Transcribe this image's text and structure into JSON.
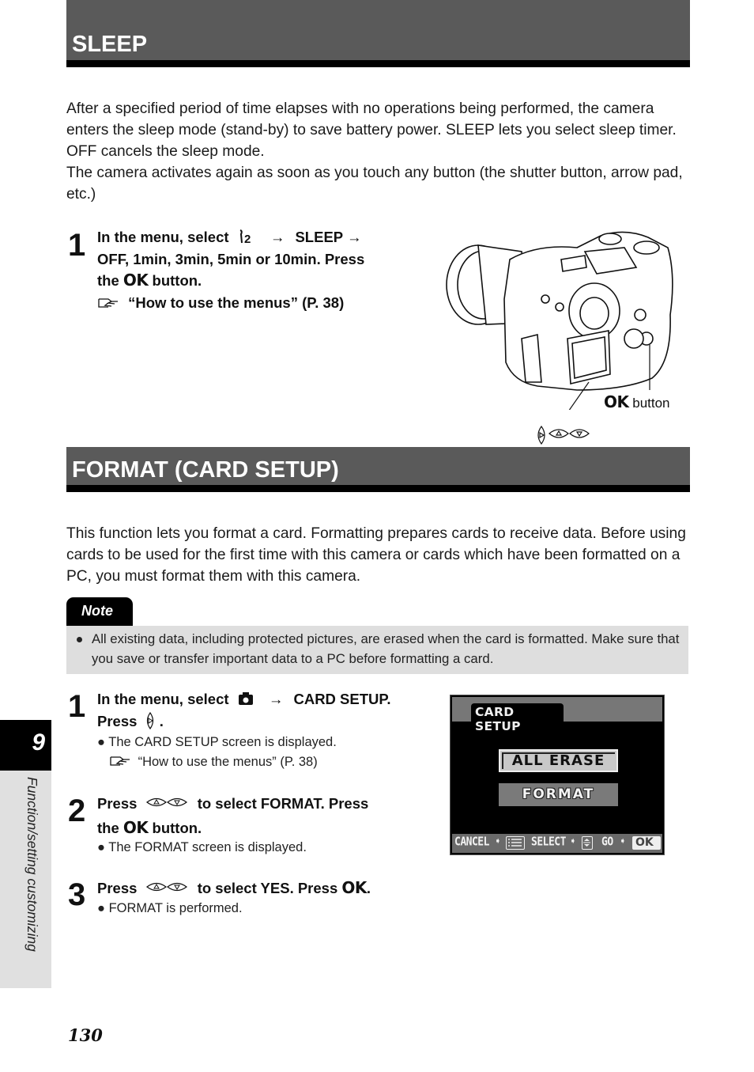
{
  "sleep": {
    "heading": "SLEEP",
    "para1": "After a specified period of time elapses with no operations being performed, the camera enters the sleep mode (stand-by) to save battery power. SLEEP lets you select sleep timer. OFF cancels the sleep mode.",
    "para2": "The camera activates again as soon as you touch any button (the shutter button, arrow pad, etc.)",
    "step1": {
      "number": "1",
      "line1_prefix": "In the menu, select",
      "menu_icon": "setup-2-tab-icon",
      "menu_icon_text": "2",
      "arrow": "→",
      "line1_item": "SLEEP",
      "line2": "OFF, 1min, 3min, 5min or 10min. Press",
      "line3_prefix": "the",
      "ok": "OK",
      "line3_suffix": "button.",
      "ref": "“How to use the menus” (P. 38)"
    },
    "figure": {
      "ok_label": "OK",
      "button_label": "button",
      "arrow_buttons": [
        "arrow-right-icon",
        "arrow-up-icon",
        "arrow-down-icon"
      ]
    }
  },
  "format": {
    "heading": "FORMAT (CARD SETUP)",
    "para": "This function lets you format a card. Formatting prepares cards to receive data. Before using cards to be used for the first time with this camera or cards which have been formatted on a PC, you must format them with this camera.",
    "note": {
      "label": "Note",
      "text": "All existing data, including protected pictures, are erased when the card is formatted. Make sure that you save or transfer important data to a PC before formatting a card."
    },
    "steps": [
      {
        "number": "1",
        "line1_prefix": "In the menu, select",
        "line1_item": "CARD SETUP.",
        "line2_prefix": "Press",
        "line2_suffix": ".",
        "bullet": "The CARD SETUP screen is displayed.",
        "ref": "“How to use the menus” (P. 38)"
      },
      {
        "number": "2",
        "line1_prefix": "Press",
        "line1_suffix": "to select FORMAT. Press",
        "line2_prefix": "the",
        "ok": "OK",
        "line2_suffix": "button.",
        "bullet": "The FORMAT screen is displayed."
      },
      {
        "number": "3",
        "line1_prefix": "Press",
        "line1_suffix": "to select YES. Press",
        "ok": "OK",
        "end": ".",
        "bullet": "FORMAT is performed."
      }
    ],
    "lcd": {
      "tab": "CARD SETUP",
      "options": [
        "ALL ERASE",
        "FORMAT"
      ],
      "selected": "ALL ERASE",
      "footer": {
        "cancel": "CANCEL",
        "select": "SELECT",
        "go": "GO",
        "ok": "OK"
      }
    }
  },
  "side_tab": {
    "chapter": "9",
    "title": "Function/setting customizing"
  },
  "page_number": "130",
  "colors": {
    "heading_bg": "#5a5a5a",
    "heading_rule": "#000000",
    "note_bg": "#dedede",
    "side_tab_bg": "#e0e0e0"
  }
}
